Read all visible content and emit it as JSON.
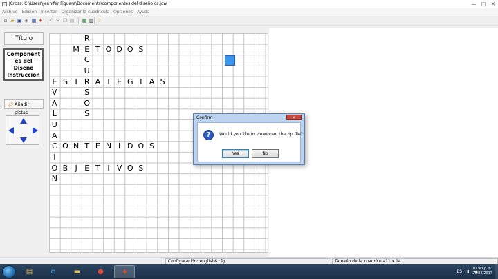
{
  "window": {
    "title": "JCross: C:\\Users\\Jennifer Figuera\\Documents\\componentes del diseño cs.jcw",
    "buttons": {
      "minimize": "—",
      "maximize": "□",
      "close": "✕"
    }
  },
  "menubar": {
    "items": [
      "Archivo",
      "Edición",
      "Insertar",
      "Organizar la cuadrícula",
      "Opciones",
      "Ayuda"
    ]
  },
  "toolbar": {
    "icons": [
      {
        "name": "new-file-icon",
        "glyph": "▫",
        "color": "#333333"
      },
      {
        "name": "open-file-icon",
        "glyph": "▰",
        "color": "#c9a227"
      },
      {
        "name": "save-icon",
        "glyph": "▣",
        "color": "#1b3d8f"
      },
      {
        "name": "export-html-icon",
        "glyph": "◈",
        "color": "#555555"
      },
      {
        "name": "export-web-icon",
        "glyph": "▦",
        "color": "#1b3d8f"
      },
      {
        "name": "hot-potatoes-icon",
        "glyph": "♦",
        "color": "#c0392b"
      },
      {
        "name": "undo-icon",
        "glyph": "↶",
        "color": "#9a9a9a"
      },
      {
        "name": "cut-icon",
        "glyph": "✂",
        "color": "#9a9a9a"
      },
      {
        "name": "copy-icon",
        "glyph": "❐",
        "color": "#9a9a9a"
      },
      {
        "name": "paste-icon",
        "glyph": "▤",
        "color": "#9a9a9a"
      },
      {
        "name": "grid-maker-icon",
        "glyph": "▦",
        "color": "#2f7d32"
      },
      {
        "name": "print-icon",
        "glyph": "▥",
        "color": "#333333"
      },
      {
        "name": "help-icon",
        "glyph": "?",
        "color": "#d4a200"
      }
    ]
  },
  "leftpanel": {
    "title_button": "Título",
    "title_lines": [
      "Component",
      "es del",
      "Diseño",
      "Instruccion"
    ],
    "add_clues_button": "Añadir pistas"
  },
  "crossword": {
    "rows": 20,
    "cols": 20,
    "cells": [
      {
        "r": 0,
        "c": 3,
        "ch": "R"
      },
      {
        "r": 1,
        "c": 2,
        "ch": "M"
      },
      {
        "r": 1,
        "c": 3,
        "ch": "E"
      },
      {
        "r": 1,
        "c": 4,
        "ch": "T"
      },
      {
        "r": 1,
        "c": 5,
        "ch": "O"
      },
      {
        "r": 1,
        "c": 6,
        "ch": "D"
      },
      {
        "r": 1,
        "c": 7,
        "ch": "O"
      },
      {
        "r": 1,
        "c": 8,
        "ch": "S"
      },
      {
        "r": 2,
        "c": 3,
        "ch": "C"
      },
      {
        "r": 3,
        "c": 3,
        "ch": "U"
      },
      {
        "r": 4,
        "c": 0,
        "ch": "E"
      },
      {
        "r": 4,
        "c": 1,
        "ch": "S"
      },
      {
        "r": 4,
        "c": 2,
        "ch": "T"
      },
      {
        "r": 4,
        "c": 3,
        "ch": "R"
      },
      {
        "r": 4,
        "c": 4,
        "ch": "A"
      },
      {
        "r": 4,
        "c": 5,
        "ch": "T"
      },
      {
        "r": 4,
        "c": 6,
        "ch": "E"
      },
      {
        "r": 4,
        "c": 7,
        "ch": "G"
      },
      {
        "r": 4,
        "c": 8,
        "ch": "I"
      },
      {
        "r": 4,
        "c": 9,
        "ch": "A"
      },
      {
        "r": 4,
        "c": 10,
        "ch": "S"
      },
      {
        "r": 5,
        "c": 0,
        "ch": "V"
      },
      {
        "r": 5,
        "c": 3,
        "ch": "S"
      },
      {
        "r": 6,
        "c": 0,
        "ch": "A"
      },
      {
        "r": 6,
        "c": 3,
        "ch": "O"
      },
      {
        "r": 7,
        "c": 0,
        "ch": "L"
      },
      {
        "r": 7,
        "c": 3,
        "ch": "S"
      },
      {
        "r": 8,
        "c": 0,
        "ch": "U"
      },
      {
        "r": 9,
        "c": 0,
        "ch": "A"
      },
      {
        "r": 10,
        "c": 0,
        "ch": "C"
      },
      {
        "r": 10,
        "c": 1,
        "ch": "O"
      },
      {
        "r": 10,
        "c": 2,
        "ch": "N"
      },
      {
        "r": 10,
        "c": 3,
        "ch": "T"
      },
      {
        "r": 10,
        "c": 4,
        "ch": "E"
      },
      {
        "r": 10,
        "c": 5,
        "ch": "N"
      },
      {
        "r": 10,
        "c": 6,
        "ch": "I"
      },
      {
        "r": 10,
        "c": 7,
        "ch": "D"
      },
      {
        "r": 10,
        "c": 8,
        "ch": "O"
      },
      {
        "r": 10,
        "c": 9,
        "ch": "S"
      },
      {
        "r": 11,
        "c": 0,
        "ch": "I"
      },
      {
        "r": 12,
        "c": 0,
        "ch": "O"
      },
      {
        "r": 12,
        "c": 1,
        "ch": "B"
      },
      {
        "r": 12,
        "c": 2,
        "ch": "J"
      },
      {
        "r": 12,
        "c": 3,
        "ch": "E"
      },
      {
        "r": 12,
        "c": 4,
        "ch": "T"
      },
      {
        "r": 12,
        "c": 5,
        "ch": "I"
      },
      {
        "r": 12,
        "c": 6,
        "ch": "V"
      },
      {
        "r": 12,
        "c": 7,
        "ch": "O"
      },
      {
        "r": 12,
        "c": 8,
        "ch": "S"
      },
      {
        "r": 13,
        "c": 0,
        "ch": "N"
      }
    ],
    "cursor_color": "#3e97ef"
  },
  "statusbar": {
    "config": "Configuración: english6.cfg",
    "grid_size": "Tamaño de la cuadrícula11 x 14"
  },
  "dialog": {
    "title": "Confirm",
    "close_glyph": "✕",
    "icon_glyph": "?",
    "message": "Would you like to view/open the zip file?",
    "yes_label": "Yes",
    "no_label": "No"
  },
  "taskbar": {
    "items": [
      {
        "name": "file-explorer-icon",
        "glyph": "▤",
        "color": "#e8c25a"
      },
      {
        "name": "internet-explorer-icon",
        "glyph": "e",
        "color": "#3aa0e8"
      },
      {
        "name": "folder-icon",
        "glyph": "▬",
        "color": "#e8c25a"
      },
      {
        "name": "chrome-icon",
        "glyph": "●",
        "color": "#e04a3a"
      },
      {
        "name": "hot-potatoes-app-icon",
        "glyph": "♦",
        "color": "#d84a2a"
      }
    ],
    "tray": {
      "language": "ES",
      "clock_time": "01:43 p.m.",
      "clock_date": "29/03/2017"
    }
  }
}
